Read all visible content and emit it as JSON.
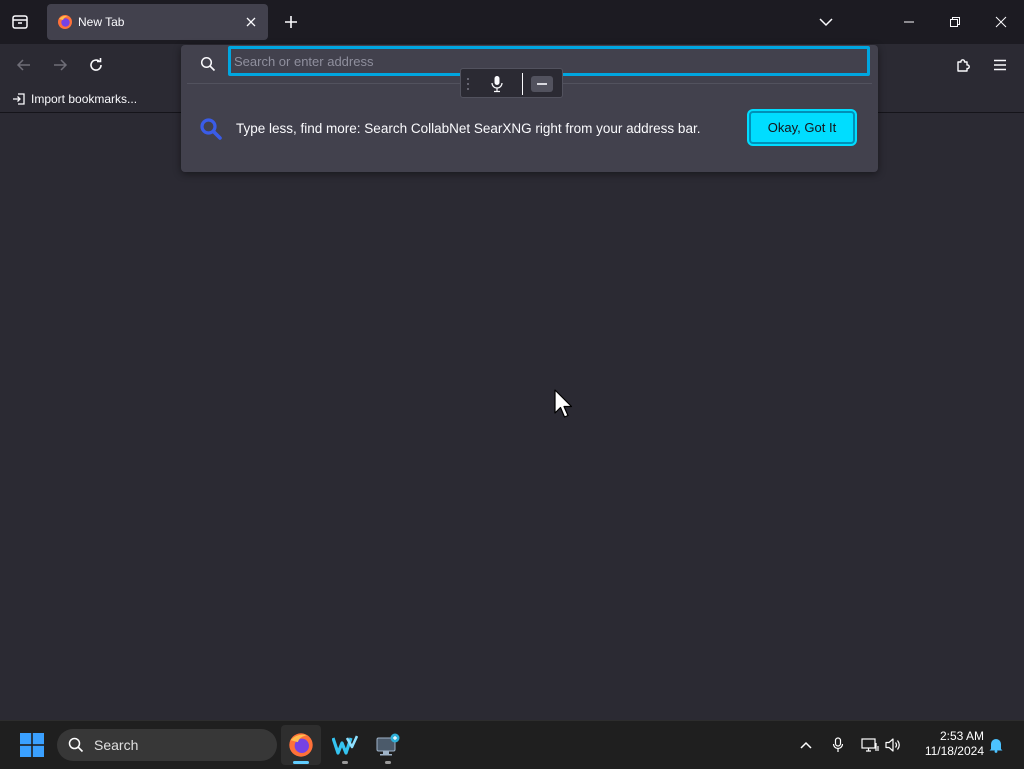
{
  "tabs": [
    {
      "title": "New Tab",
      "active": true
    }
  ],
  "urlbar": {
    "placeholder": "Search or enter address",
    "value": "",
    "tip_text": "Type less, find more: Search CollabNet SearXNG right from your address bar.",
    "tip_button_label": "Okay, Got It"
  },
  "bookmarks": {
    "items": [
      {
        "label": "Import bookmarks..."
      }
    ]
  },
  "taskbar": {
    "search_label": "Search",
    "apps": [
      {
        "name": "firefox",
        "active": true
      },
      {
        "name": "windsurf-app",
        "active": false
      },
      {
        "name": "remote-desktop-app",
        "active": false
      }
    ],
    "clock": {
      "time": "2:53 AM",
      "date": "11/18/2024"
    }
  },
  "colors": {
    "accent": "#00ddff",
    "focus_ring": "#00a6e0",
    "content_bg": "#2b2a33",
    "toolbar_bg": "#1c1b22",
    "popup_bg": "#42414d"
  }
}
